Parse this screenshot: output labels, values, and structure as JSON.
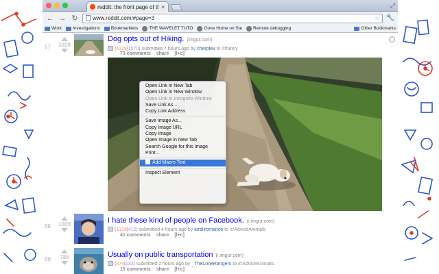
{
  "window": {
    "tab_title": "reddit: the front page of the",
    "url": "www.reddit.com/#page=3",
    "bookmarks": [
      {
        "label": "Work",
        "icon": "folder-icon"
      },
      {
        "label": "Investigations",
        "icon": "folder-icon"
      },
      {
        "label": "Bookmarklets",
        "icon": "folder-icon"
      },
      {
        "label": "THE WAVELET TUTO",
        "icon": "bookmark-icon"
      },
      {
        "label": "Gone Home on Ste",
        "icon": "bookmark-icon"
      },
      {
        "label": "Remote debugging",
        "icon": "bookmark-icon"
      }
    ],
    "other_bookmarks": "Other Bookmarks"
  },
  "posts": [
    {
      "rank": "57",
      "score": "2628",
      "title": "Dog opts out of Hiking.",
      "domain": "(imgur.com)",
      "ups": "4229",
      "downs": "1570",
      "submitted": "submitted 7 hours ago by",
      "author": "cherplex",
      "to": "to /r/funny",
      "comments": "73 comments",
      "share": "share",
      "extra": "[l+c]"
    },
    {
      "rank": "58",
      "score": "1009",
      "title": "I hate these kind of people on Facebook.",
      "domain": "(i.imgur.com)",
      "ups": "1318",
      "downs": "412",
      "submitted": "submitted 4 hours ago by",
      "author": "loraliromance",
      "to": "to /r/AdviceAnimals",
      "comments": "41 comments",
      "share": "share",
      "extra": "[l+c]"
    },
    {
      "rank": "59",
      "score": "786",
      "title": "Usually on public transportation",
      "domain": "(i.imgur.com)",
      "ups": "874",
      "downs": "133",
      "submitted": "submitted 2 hours ago by",
      "author": "_TheLoneRangers",
      "to": "to /r/AdviceAnimals",
      "comments": "15 comments",
      "share": "share",
      "extra": "[l+c]"
    }
  ],
  "context_menu": {
    "items": [
      {
        "label": "Open Link in New Tab",
        "disabled": false
      },
      {
        "label": "Open Link in New Window",
        "disabled": false
      },
      {
        "label": "Open Link in Incognito Window",
        "disabled": true
      },
      {
        "label": "Save Link As...",
        "disabled": false
      },
      {
        "label": "Copy Link Address",
        "disabled": false
      },
      {
        "label": "Save Image As...",
        "disabled": false
      },
      {
        "label": "Copy Image URL",
        "disabled": false
      },
      {
        "label": "Copy Image",
        "disabled": false
      },
      {
        "label": "Open Image in New Tab",
        "disabled": false
      },
      {
        "label": "Search Google for this Image",
        "disabled": false
      },
      {
        "label": "Print...",
        "disabled": false
      },
      {
        "label": "Add Macro Text",
        "highlighted": true
      },
      {
        "label": "Inspect Element",
        "disabled": false
      }
    ]
  },
  "colors": {
    "link_blue": "#0000ff",
    "upvote_orange": "#ff8b60",
    "downvote_blue": "#9494ff",
    "menu_highlight": "#3876d8",
    "doodle_blue": "#2a56c6",
    "doodle_red": "#e03a2a"
  }
}
